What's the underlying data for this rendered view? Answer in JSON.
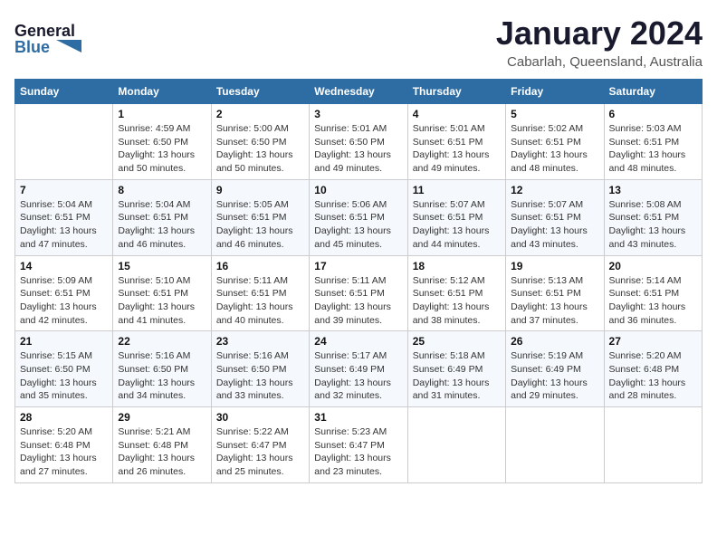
{
  "header": {
    "logo_line1": "General",
    "logo_line2": "Blue",
    "month": "January 2024",
    "location": "Cabarlah, Queensland, Australia"
  },
  "days_of_week": [
    "Sunday",
    "Monday",
    "Tuesday",
    "Wednesday",
    "Thursday",
    "Friday",
    "Saturday"
  ],
  "weeks": [
    [
      {
        "day": "",
        "sunrise": "",
        "sunset": "",
        "daylight": ""
      },
      {
        "day": "1",
        "sunrise": "Sunrise: 4:59 AM",
        "sunset": "Sunset: 6:50 PM",
        "daylight": "Daylight: 13 hours and 50 minutes."
      },
      {
        "day": "2",
        "sunrise": "Sunrise: 5:00 AM",
        "sunset": "Sunset: 6:50 PM",
        "daylight": "Daylight: 13 hours and 50 minutes."
      },
      {
        "day": "3",
        "sunrise": "Sunrise: 5:01 AM",
        "sunset": "Sunset: 6:50 PM",
        "daylight": "Daylight: 13 hours and 49 minutes."
      },
      {
        "day": "4",
        "sunrise": "Sunrise: 5:01 AM",
        "sunset": "Sunset: 6:51 PM",
        "daylight": "Daylight: 13 hours and 49 minutes."
      },
      {
        "day": "5",
        "sunrise": "Sunrise: 5:02 AM",
        "sunset": "Sunset: 6:51 PM",
        "daylight": "Daylight: 13 hours and 48 minutes."
      },
      {
        "day": "6",
        "sunrise": "Sunrise: 5:03 AM",
        "sunset": "Sunset: 6:51 PM",
        "daylight": "Daylight: 13 hours and 48 minutes."
      }
    ],
    [
      {
        "day": "7",
        "sunrise": "Sunrise: 5:04 AM",
        "sunset": "Sunset: 6:51 PM",
        "daylight": "Daylight: 13 hours and 47 minutes."
      },
      {
        "day": "8",
        "sunrise": "Sunrise: 5:04 AM",
        "sunset": "Sunset: 6:51 PM",
        "daylight": "Daylight: 13 hours and 46 minutes."
      },
      {
        "day": "9",
        "sunrise": "Sunrise: 5:05 AM",
        "sunset": "Sunset: 6:51 PM",
        "daylight": "Daylight: 13 hours and 46 minutes."
      },
      {
        "day": "10",
        "sunrise": "Sunrise: 5:06 AM",
        "sunset": "Sunset: 6:51 PM",
        "daylight": "Daylight: 13 hours and 45 minutes."
      },
      {
        "day": "11",
        "sunrise": "Sunrise: 5:07 AM",
        "sunset": "Sunset: 6:51 PM",
        "daylight": "Daylight: 13 hours and 44 minutes."
      },
      {
        "day": "12",
        "sunrise": "Sunrise: 5:07 AM",
        "sunset": "Sunset: 6:51 PM",
        "daylight": "Daylight: 13 hours and 43 minutes."
      },
      {
        "day": "13",
        "sunrise": "Sunrise: 5:08 AM",
        "sunset": "Sunset: 6:51 PM",
        "daylight": "Daylight: 13 hours and 43 minutes."
      }
    ],
    [
      {
        "day": "14",
        "sunrise": "Sunrise: 5:09 AM",
        "sunset": "Sunset: 6:51 PM",
        "daylight": "Daylight: 13 hours and 42 minutes."
      },
      {
        "day": "15",
        "sunrise": "Sunrise: 5:10 AM",
        "sunset": "Sunset: 6:51 PM",
        "daylight": "Daylight: 13 hours and 41 minutes."
      },
      {
        "day": "16",
        "sunrise": "Sunrise: 5:11 AM",
        "sunset": "Sunset: 6:51 PM",
        "daylight": "Daylight: 13 hours and 40 minutes."
      },
      {
        "day": "17",
        "sunrise": "Sunrise: 5:11 AM",
        "sunset": "Sunset: 6:51 PM",
        "daylight": "Daylight: 13 hours and 39 minutes."
      },
      {
        "day": "18",
        "sunrise": "Sunrise: 5:12 AM",
        "sunset": "Sunset: 6:51 PM",
        "daylight": "Daylight: 13 hours and 38 minutes."
      },
      {
        "day": "19",
        "sunrise": "Sunrise: 5:13 AM",
        "sunset": "Sunset: 6:51 PM",
        "daylight": "Daylight: 13 hours and 37 minutes."
      },
      {
        "day": "20",
        "sunrise": "Sunrise: 5:14 AM",
        "sunset": "Sunset: 6:51 PM",
        "daylight": "Daylight: 13 hours and 36 minutes."
      }
    ],
    [
      {
        "day": "21",
        "sunrise": "Sunrise: 5:15 AM",
        "sunset": "Sunset: 6:50 PM",
        "daylight": "Daylight: 13 hours and 35 minutes."
      },
      {
        "day": "22",
        "sunrise": "Sunrise: 5:16 AM",
        "sunset": "Sunset: 6:50 PM",
        "daylight": "Daylight: 13 hours and 34 minutes."
      },
      {
        "day": "23",
        "sunrise": "Sunrise: 5:16 AM",
        "sunset": "Sunset: 6:50 PM",
        "daylight": "Daylight: 13 hours and 33 minutes."
      },
      {
        "day": "24",
        "sunrise": "Sunrise: 5:17 AM",
        "sunset": "Sunset: 6:49 PM",
        "daylight": "Daylight: 13 hours and 32 minutes."
      },
      {
        "day": "25",
        "sunrise": "Sunrise: 5:18 AM",
        "sunset": "Sunset: 6:49 PM",
        "daylight": "Daylight: 13 hours and 31 minutes."
      },
      {
        "day": "26",
        "sunrise": "Sunrise: 5:19 AM",
        "sunset": "Sunset: 6:49 PM",
        "daylight": "Daylight: 13 hours and 29 minutes."
      },
      {
        "day": "27",
        "sunrise": "Sunrise: 5:20 AM",
        "sunset": "Sunset: 6:48 PM",
        "daylight": "Daylight: 13 hours and 28 minutes."
      }
    ],
    [
      {
        "day": "28",
        "sunrise": "Sunrise: 5:20 AM",
        "sunset": "Sunset: 6:48 PM",
        "daylight": "Daylight: 13 hours and 27 minutes."
      },
      {
        "day": "29",
        "sunrise": "Sunrise: 5:21 AM",
        "sunset": "Sunset: 6:48 PM",
        "daylight": "Daylight: 13 hours and 26 minutes."
      },
      {
        "day": "30",
        "sunrise": "Sunrise: 5:22 AM",
        "sunset": "Sunset: 6:47 PM",
        "daylight": "Daylight: 13 hours and 25 minutes."
      },
      {
        "day": "31",
        "sunrise": "Sunrise: 5:23 AM",
        "sunset": "Sunset: 6:47 PM",
        "daylight": "Daylight: 13 hours and 23 minutes."
      },
      {
        "day": "",
        "sunrise": "",
        "sunset": "",
        "daylight": ""
      },
      {
        "day": "",
        "sunrise": "",
        "sunset": "",
        "daylight": ""
      },
      {
        "day": "",
        "sunrise": "",
        "sunset": "",
        "daylight": ""
      }
    ]
  ]
}
